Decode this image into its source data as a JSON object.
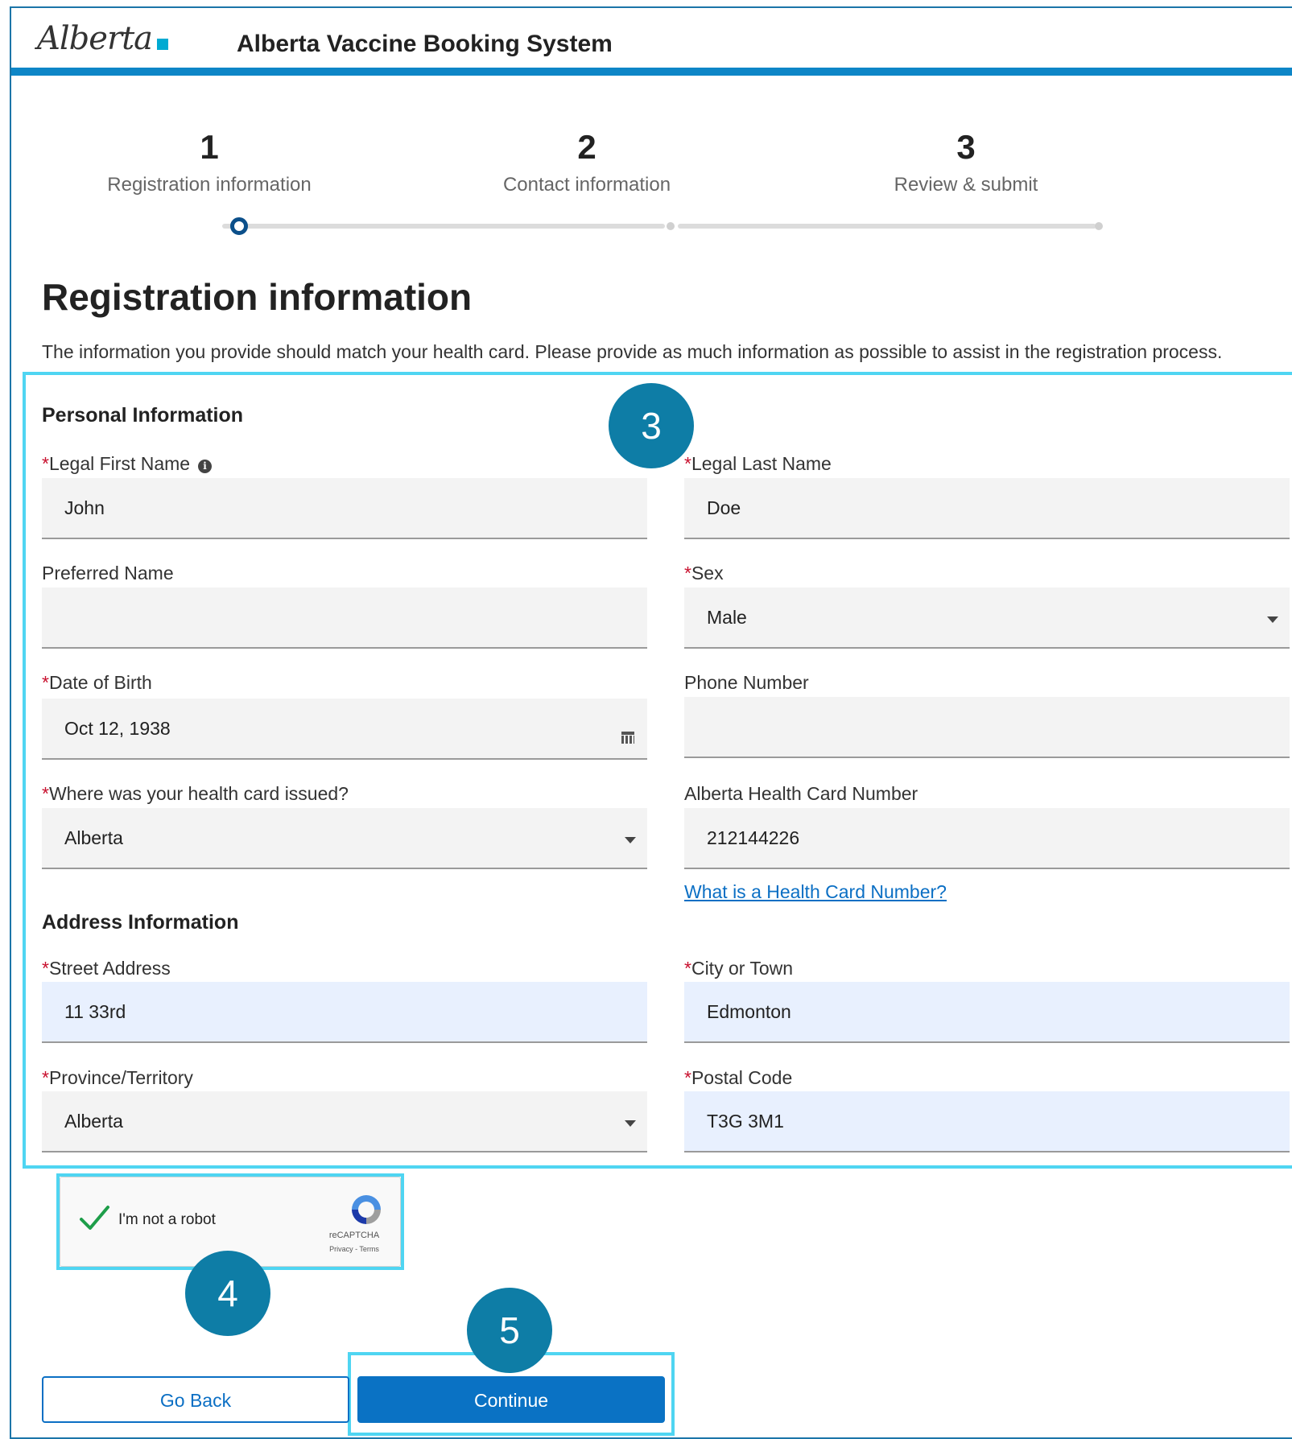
{
  "header": {
    "logo_text": "Alberta",
    "app_title": "Alberta Vaccine Booking System"
  },
  "stepper": {
    "steps": [
      {
        "number": "1",
        "label": "Registration information"
      },
      {
        "number": "2",
        "label": "Contact information"
      },
      {
        "number": "3",
        "label": "Review & submit"
      }
    ],
    "current_step": 1
  },
  "page": {
    "title": "Registration information",
    "intro": "The information you provide should match your health card. Please provide as much information as possible to assist in the registration process."
  },
  "personal": {
    "section_title": "Personal Information",
    "first_name": {
      "label": "Legal First Name",
      "value": "John"
    },
    "last_name": {
      "label": "Legal Last Name",
      "value": "Doe"
    },
    "preferred_name": {
      "label": "Preferred Name",
      "value": ""
    },
    "sex": {
      "label": "Sex",
      "value": "Male"
    },
    "dob": {
      "label": "Date of Birth",
      "value": "Oct 12, 1938"
    },
    "phone": {
      "label": "Phone Number",
      "value": ""
    },
    "card_issued": {
      "label": "Where was your health card issued?",
      "value": "Alberta"
    },
    "health_card": {
      "label": "Alberta Health Card Number",
      "value": "212144226"
    },
    "health_card_link": "What is a Health Card Number?"
  },
  "address": {
    "section_title": "Address Information",
    "street": {
      "label": "Street Address",
      "value": "11 33rd"
    },
    "city": {
      "label": "City or Town",
      "value": "Edmonton"
    },
    "province": {
      "label": "Province/Territory",
      "value": "Alberta"
    },
    "postal": {
      "label": "Postal Code",
      "value": "T3G 3M1"
    }
  },
  "required_marker": "*",
  "info_icon": "i",
  "captcha": {
    "label": "I'm not a robot",
    "brand": "reCAPTCHA",
    "links": "Privacy - Terms",
    "checked": true
  },
  "buttons": {
    "back": "Go Back",
    "continue": "Continue"
  },
  "annotations": {
    "badge_3": "3",
    "badge_4": "4",
    "badge_5": "5"
  },
  "colors": {
    "brand_blue": "#0e86c7",
    "primary_button": "#0a72c4",
    "highlight": "#4fd5f2",
    "badge": "#0e7da6",
    "required": "#c8102e"
  }
}
